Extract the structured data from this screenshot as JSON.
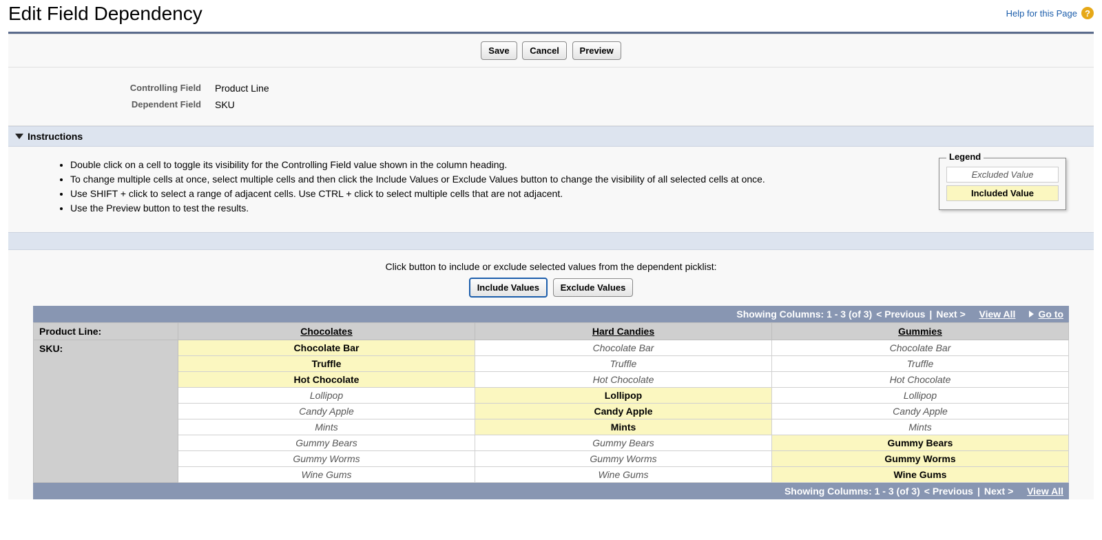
{
  "header": {
    "title": "Edit Field Dependency",
    "help_label": "Help for this Page",
    "help_icon_char": "?"
  },
  "toolbar": {
    "save": "Save",
    "cancel": "Cancel",
    "preview": "Preview"
  },
  "fields": {
    "controlling_label": "Controlling Field",
    "controlling_value": "Product Line",
    "dependent_label": "Dependent Field",
    "dependent_value": "SKU"
  },
  "instructions": {
    "title": "Instructions",
    "items": [
      "Double click on a cell to toggle its visibility for the Controlling Field value shown in the column heading.",
      "To change multiple cells at once, select multiple cells and then click the Include Values or Exclude Values button to change the visibility of all selected cells at once.",
      "Use SHIFT + click to select a range of adjacent cells. Use CTRL + click to select multiple cells that are not adjacent.",
      "Use the Preview button to test the results."
    ]
  },
  "legend": {
    "title": "Legend",
    "excluded": "Excluded Value",
    "included": "Included Value"
  },
  "actions": {
    "prompt": "Click button to include or exclude selected values from the dependent picklist:",
    "include": "Include Values",
    "exclude": "Exclude Values"
  },
  "nav": {
    "showing": "Showing Columns: 1 - 3 (of 3)",
    "previous": "< Previous",
    "next": "Next >",
    "view_all": "View All",
    "goto": "Go to"
  },
  "matrix": {
    "controlling_label": "Product Line:",
    "dependent_label": "SKU:",
    "columns": [
      "Chocolates",
      "Hard Candies",
      "Gummies"
    ],
    "rows": [
      {
        "name": "Chocolate Bar",
        "included": [
          true,
          false,
          false
        ]
      },
      {
        "name": "Truffle",
        "included": [
          true,
          false,
          false
        ]
      },
      {
        "name": "Hot Chocolate",
        "included": [
          true,
          false,
          false
        ]
      },
      {
        "name": "Lollipop",
        "included": [
          false,
          true,
          false
        ]
      },
      {
        "name": "Candy Apple",
        "included": [
          false,
          true,
          false
        ]
      },
      {
        "name": "Mints",
        "included": [
          false,
          true,
          false
        ]
      },
      {
        "name": "Gummy Bears",
        "included": [
          false,
          false,
          true
        ]
      },
      {
        "name": "Gummy Worms",
        "included": [
          false,
          false,
          true
        ]
      },
      {
        "name": "Wine Gums",
        "included": [
          false,
          false,
          true
        ]
      }
    ]
  }
}
